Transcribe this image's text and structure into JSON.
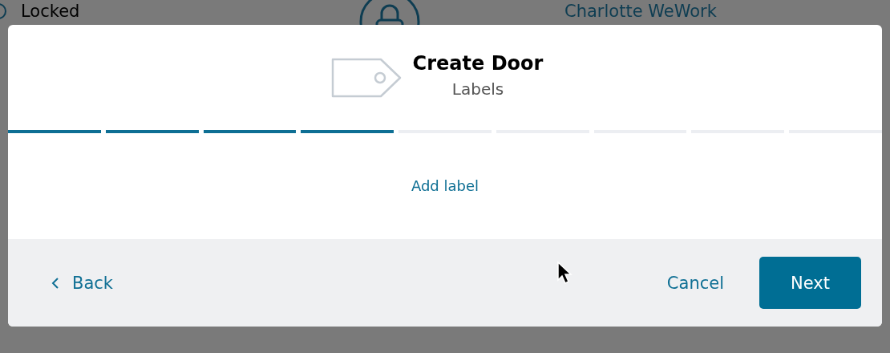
{
  "background_row": {
    "selected": false,
    "status": "Locked",
    "location": "Charlotte WeWork"
  },
  "dialog": {
    "title": "Create Door",
    "subtitle": "Labels",
    "steps": [
      {
        "done": true
      },
      {
        "done": true
      },
      {
        "done": true
      },
      {
        "done": true
      },
      {
        "done": false
      },
      {
        "done": false
      },
      {
        "done": false
      },
      {
        "done": false
      },
      {
        "done": false
      }
    ],
    "add_link": "Add label",
    "back": "Back",
    "cancel": "Cancel",
    "next": "Next"
  }
}
